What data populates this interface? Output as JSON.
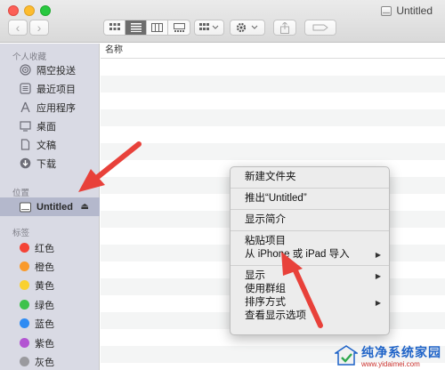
{
  "window": {
    "title": "Untitled",
    "icon": "drive-icon"
  },
  "toolbar": {
    "back": "‹",
    "forward": "›",
    "view_buttons": [
      "icon-view",
      "list-view",
      "column-view",
      "gallery-view"
    ],
    "active_view": "list-view"
  },
  "sidebar": {
    "favorites_heading": "个人收藏",
    "favorites": [
      {
        "label": "隔空投送",
        "icon": "airdrop-icon"
      },
      {
        "label": "最近项目",
        "icon": "recents-icon"
      },
      {
        "label": "应用程序",
        "icon": "applications-icon"
      },
      {
        "label": "桌面",
        "icon": "desktop-icon"
      },
      {
        "label": "文稿",
        "icon": "documents-icon"
      },
      {
        "label": "下载",
        "icon": "downloads-icon"
      }
    ],
    "locations_heading": "位置",
    "locations": [
      {
        "label": "Untitled",
        "icon": "drive-icon",
        "eject": "⏏"
      }
    ],
    "tags_heading": "标签",
    "tags": [
      {
        "label": "红色",
        "color": "#f44336"
      },
      {
        "label": "橙色",
        "color": "#f99a2c"
      },
      {
        "label": "黄色",
        "color": "#f9d130"
      },
      {
        "label": "绿色",
        "color": "#3ec24b"
      },
      {
        "label": "蓝色",
        "color": "#2f8cf3"
      },
      {
        "label": "紫色",
        "color": "#b355d2"
      },
      {
        "label": "灰色",
        "color": "#9a9a9e"
      }
    ]
  },
  "content": {
    "column_name": "名称"
  },
  "context_menu": {
    "group1": [
      "新建文件夹"
    ],
    "group2": [
      "推出“Untitled”"
    ],
    "group3": [
      "显示简介"
    ],
    "group4": [
      {
        "label": "粘贴项目",
        "submenu": false
      },
      {
        "label": "从 iPhone 或 iPad 导入",
        "submenu": true
      }
    ],
    "group5": [
      {
        "label": "显示",
        "submenu": true
      },
      {
        "label": "使用群组",
        "submenu": false
      },
      {
        "label": "排序方式",
        "submenu": true
      },
      {
        "label": "查看显示选项",
        "submenu": false
      }
    ],
    "submenu_arrow": "▶"
  },
  "watermark": {
    "title": "纯净系统家园",
    "url": "www.yidaimei.com"
  },
  "colors": {
    "annotation_arrow": "#e8413a",
    "sidebar_bg": "#d9dae4",
    "selected_bg": "#b4b8cc"
  }
}
